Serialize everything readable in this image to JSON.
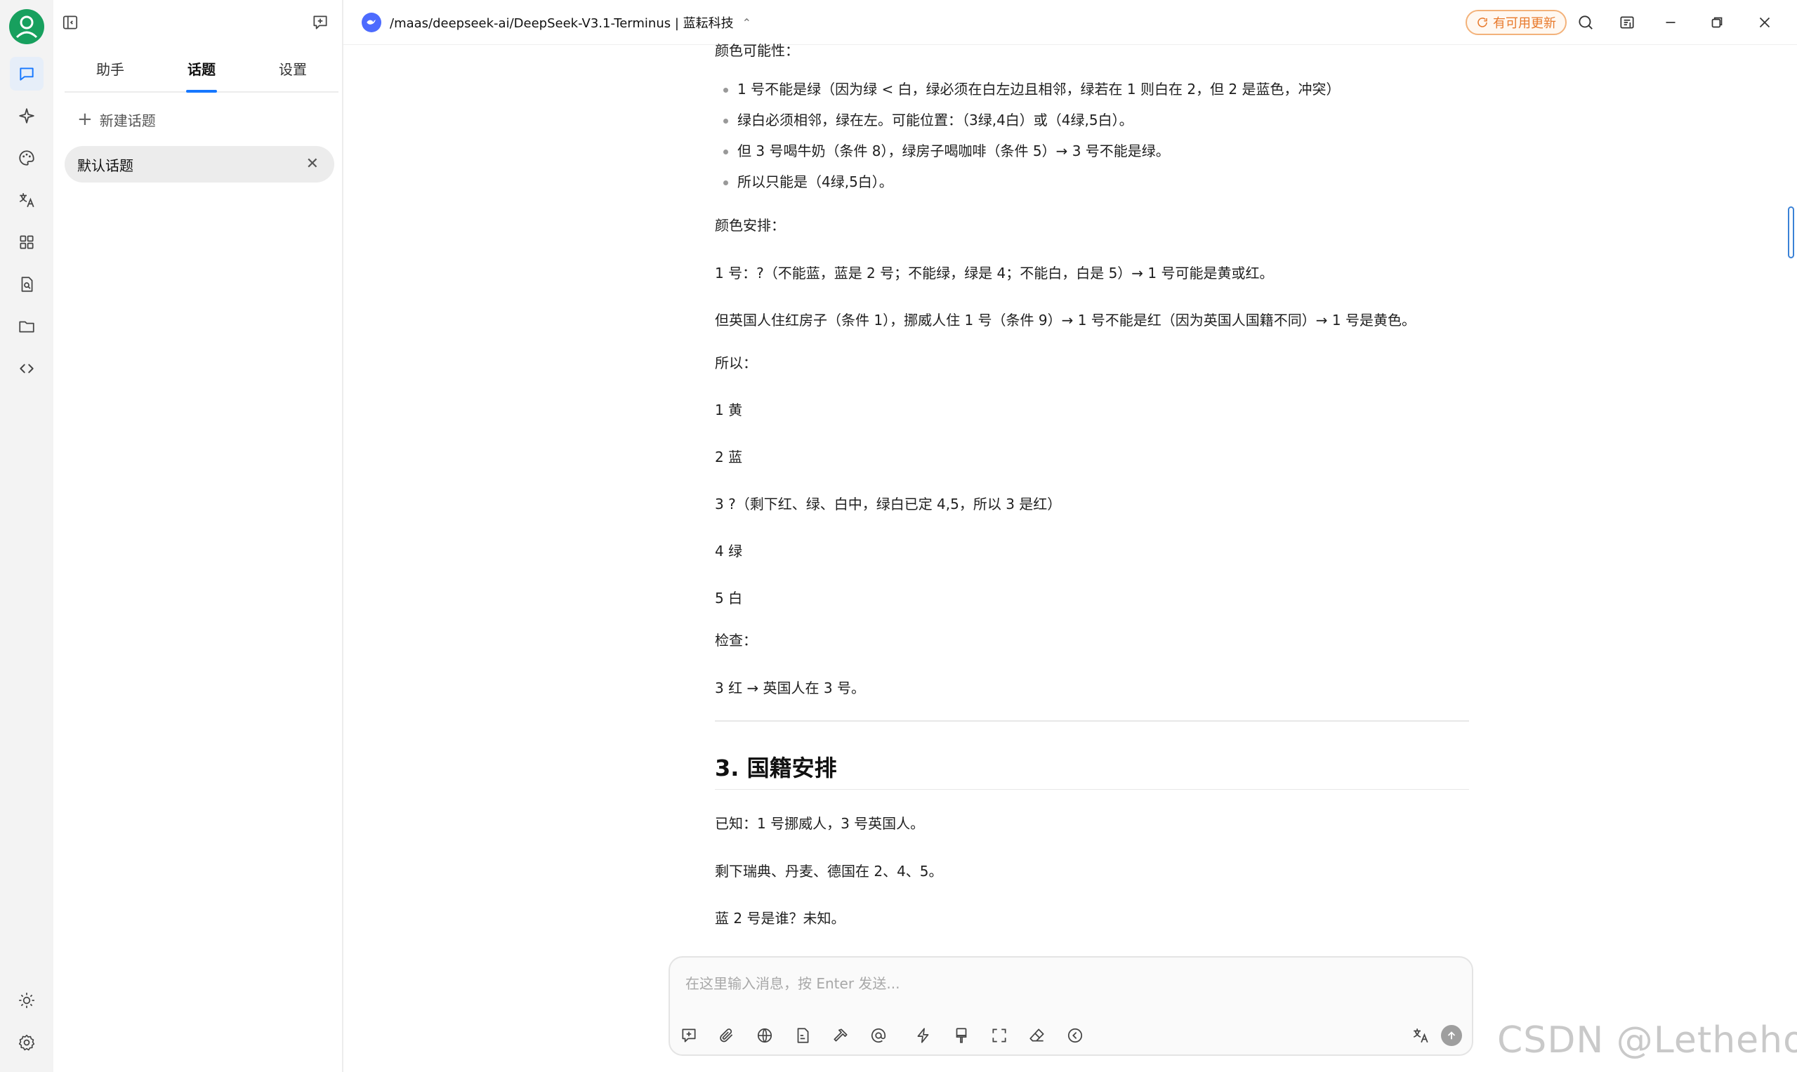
{
  "header": {
    "model_name": "/maas/deepseek-ai/DeepSeek-V3.1-Terminus | 蓝耘科技",
    "update_label": "有可用更新"
  },
  "sidebar": {
    "tabs": [
      "助手",
      "话题",
      "设置"
    ],
    "active_tab": "话题",
    "new_topic_label": "新建话题",
    "topics": [
      {
        "label": "默认话题"
      }
    ]
  },
  "message": {
    "color_possibility_title": "颜色可能性：",
    "color_possibility_items": [
      "1 号不能是绿（因为绿 < 白，绿必须在白左边且相邻，绿若在 1 则白在 2，但 2 是蓝色，冲突）",
      "绿白必须相邻，绿在左。可能位置：（3绿,4白）或（4绿,5白）。",
      "但 3 号喝牛奶（条件 8），绿房子喝咖啡（条件 5）→ 3 号不能是绿。",
      "所以只能是（4绿,5白）。"
    ],
    "color_arrangement_title": "颜色安排：",
    "line_1": "1 号：?（不能蓝，蓝是 2 号；不能绿，绿是 4；不能白，白是 5）→ 1 号可能是黄或红。",
    "line_2": "但英国人住红房子（条件 1），挪威人住 1 号（条件 9）→ 1 号不能是红（因为英国人国籍不同）→ 1 号是黄色。",
    "so_label": "所以：",
    "arrangement": [
      "1 黄",
      "2 蓝",
      "3 ?（剩下红、绿、白中，绿白已定 4,5，所以 3 是红）",
      "4 绿",
      "5 白"
    ],
    "check_label": "检查：",
    "check_line": "3 红 → 英国人在 3 号。",
    "section_heading": "3. 国籍安排",
    "known_line": "已知：1 号挪威人，3 号英国人。",
    "remaining_line": "剩下瑞典、丹麦、德国在 2、4、5。",
    "question_line": "蓝 2 号是谁？未知。"
  },
  "composer": {
    "placeholder": "在这里输入消息，按 Enter 发送..."
  },
  "watermark": "CSDN @Lethehong",
  "colors": {
    "accent": "#1677ff",
    "avatar": "#17a05e",
    "update": "#e8792b",
    "deepseek": "#4d6bfe"
  },
  "icons": {
    "rail": [
      "chat-icon",
      "sparkle-icon",
      "palette-icon",
      "translate-icon",
      "apps-grid-icon",
      "file-search-icon",
      "folder-icon",
      "code-icon",
      "sun-icon",
      "settings-icon"
    ],
    "composer_tools": [
      "new-topic-icon",
      "paperclip-icon",
      "globe-icon",
      "file-icon",
      "hammer-icon",
      "at-icon",
      "lightning-icon",
      "brush-icon",
      "expand-icon",
      "eraser-icon",
      "back-circle-icon"
    ]
  }
}
